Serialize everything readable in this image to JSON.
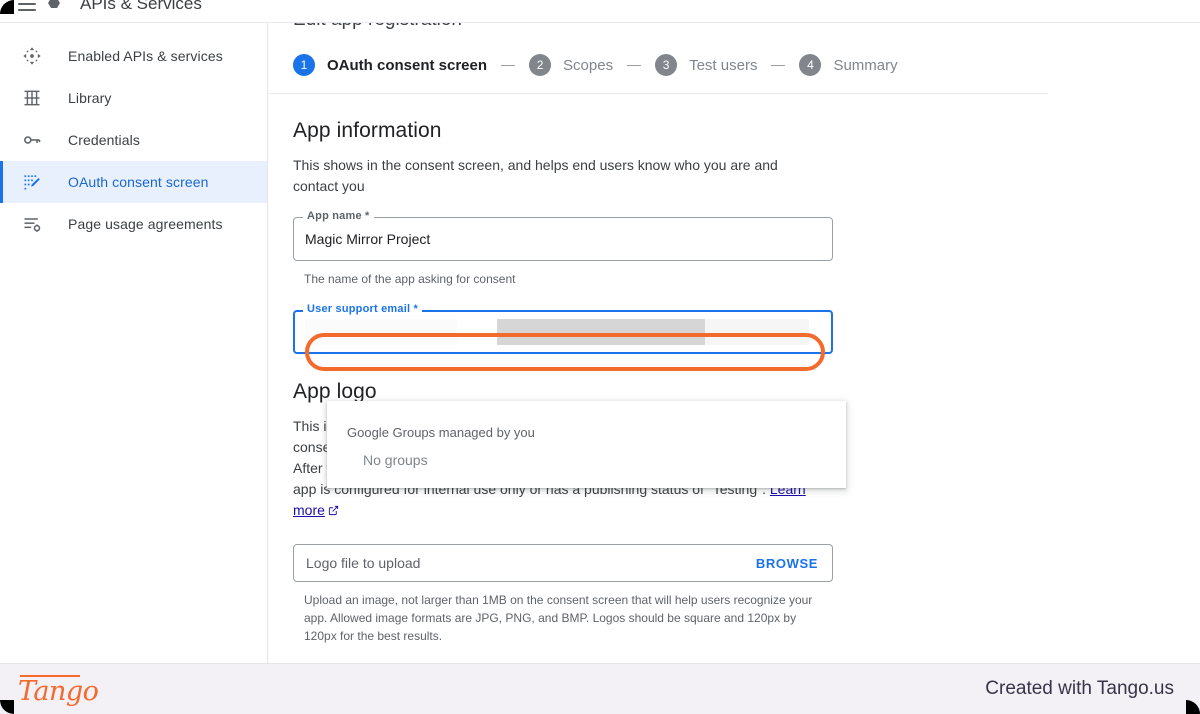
{
  "topbar": {
    "menu_icon": "hamburger-menu-icon",
    "product_icon": "google-cloud-icon",
    "title": "APIs & Services"
  },
  "sidebar": {
    "items": [
      {
        "label": "Enabled APIs & services",
        "icon": "dashboard-apis-icon",
        "active": false
      },
      {
        "label": "Library",
        "icon": "library-columns-icon",
        "active": false
      },
      {
        "label": "Credentials",
        "icon": "key-icon",
        "active": false
      },
      {
        "label": "OAuth consent screen",
        "icon": "consent-screen-icon",
        "active": true
      },
      {
        "label": "Page usage agreements",
        "icon": "page-usage-agreements-icon",
        "active": false
      }
    ]
  },
  "main": {
    "breadcrumb_title": "Edit app registration",
    "stepper": [
      {
        "num": "1",
        "label": "OAuth consent screen",
        "current": true
      },
      {
        "num": "2",
        "label": "Scopes",
        "current": false
      },
      {
        "num": "3",
        "label": "Test users",
        "current": false
      },
      {
        "num": "4",
        "label": "Summary",
        "current": false
      }
    ],
    "app_info": {
      "title": "App information",
      "description": "This shows in the consent screen, and helps end users know who you are and contact you",
      "app_name": {
        "label": "App name *",
        "value": "Magic Mirror Project",
        "help": "The name of the app asking for consent"
      },
      "user_support_email": {
        "label": "User support email *",
        "value": "",
        "redacted": true
      }
    },
    "dropdown": {
      "group_header": "Google Groups managed by you",
      "empty_item": "No groups"
    },
    "app_logo": {
      "title": "App logo",
      "line1": "This is your logo. It helps people recognize your app and is displayed on the OAuth consent screen.",
      "line2": "After you upload a logo, you will need to submit your app for verification unless the app is configured for internal use only or has a publishing status of \"Testing\".",
      "learn_more": "Learn more",
      "upload_placeholder": "Logo file to upload",
      "browse_label": "BROWSE",
      "upload_help": "Upload an image, not larger than 1MB on the consent screen that will help users recognize your app. Allowed image formats are JPG, PNG, and BMP. Logos should be square and 120px by 120px for the best results."
    }
  },
  "footer": {
    "brand": "Tango",
    "created_with": "Created with Tango.us"
  },
  "colors": {
    "accent_blue": "#1a73e8",
    "highlight_orange": "#f4692c",
    "active_nav_bg": "#e8f0fe",
    "footer_bg": "#f4f1f6"
  }
}
